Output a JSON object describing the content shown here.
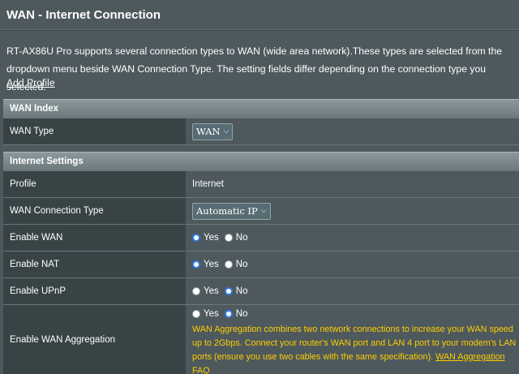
{
  "page": {
    "title": "WAN - Internet Connection",
    "description": "RT-AX86U Pro supports several connection types to WAN (wide area network).These types are selected from the dropdown menu beside WAN Connection Type. The setting fields differ depending on the connection type you selected.",
    "add_profile": "Add Profile"
  },
  "wan_index": {
    "header": "WAN Index",
    "wan_type": {
      "label": "WAN Type",
      "value": "WAN"
    }
  },
  "internet_settings": {
    "header": "Internet Settings",
    "profile": {
      "label": "Profile",
      "value": "Internet"
    },
    "connection_type": {
      "label": "WAN Connection Type",
      "value": "Automatic IP"
    },
    "enable_wan": {
      "label": "Enable WAN",
      "yes": "Yes",
      "no": "No",
      "selected": "Yes"
    },
    "enable_nat": {
      "label": "Enable NAT",
      "yes": "Yes",
      "no": "No",
      "selected": "Yes"
    },
    "enable_upnp": {
      "label": "Enable UPnP",
      "yes": "Yes",
      "no": "No",
      "selected": "No"
    },
    "enable_aggregation": {
      "label": "Enable WAN Aggregation",
      "yes": "Yes",
      "no": "No",
      "selected": "No",
      "note": "WAN Aggregation combines two network connections to increase your WAN speed up to 2Gbps. Connect your router's WAN port and LAN 4 port to your modem's LAN ports (ensure you use two cables with the same specification).",
      "faq_link": "WAN Aggregation FAQ"
    }
  },
  "colors": {
    "background": "#4d595d",
    "label_cell": "#384346",
    "accent_radio": "#2f7be8",
    "note_text": "#ffcc00"
  },
  "icons": {
    "dropdown": "chevron-down-icon"
  }
}
